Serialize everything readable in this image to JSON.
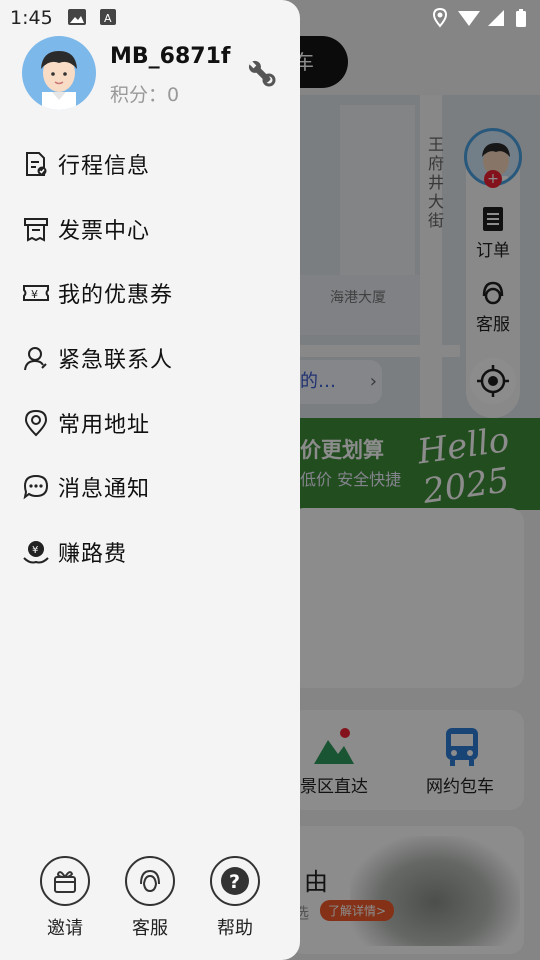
{
  "status_bar": {
    "time": "1:45"
  },
  "drawer": {
    "username": "MB_6871f",
    "points": "积分：0",
    "menu": [
      {
        "label": "行程信息",
        "icon": "trip-doc-icon"
      },
      {
        "label": "发票中心",
        "icon": "invoice-icon"
      },
      {
        "label": "我的优惠券",
        "icon": "coupon-icon"
      },
      {
        "label": "紧急联系人",
        "icon": "contact-person-icon"
      },
      {
        "label": "常用地址",
        "icon": "location-pin-icon"
      },
      {
        "label": "消息通知",
        "icon": "chat-bubble-icon"
      },
      {
        "label": "赚路费",
        "icon": "earn-money-icon"
      }
    ],
    "bottom_actions": [
      {
        "label": "邀请",
        "icon": "gift-icon"
      },
      {
        "label": "客服",
        "icon": "headset-icon"
      },
      {
        "label": "帮助",
        "icon": "help-icon"
      }
    ]
  },
  "background": {
    "car_pill": "车",
    "street_name": "王府井大街",
    "poi": "海港大厦",
    "rail": {
      "orders": "订单",
      "service": "客服"
    },
    "destination_snippet": "的…",
    "banner": {
      "title": "价更划算",
      "subtitle": "低价  安全快捷",
      "hello": "Hello 2025"
    },
    "services": [
      "景区直达",
      "网约包车"
    ],
    "promo": {
      "title": "由",
      "sub": "选",
      "tag": "了解详情>"
    }
  }
}
